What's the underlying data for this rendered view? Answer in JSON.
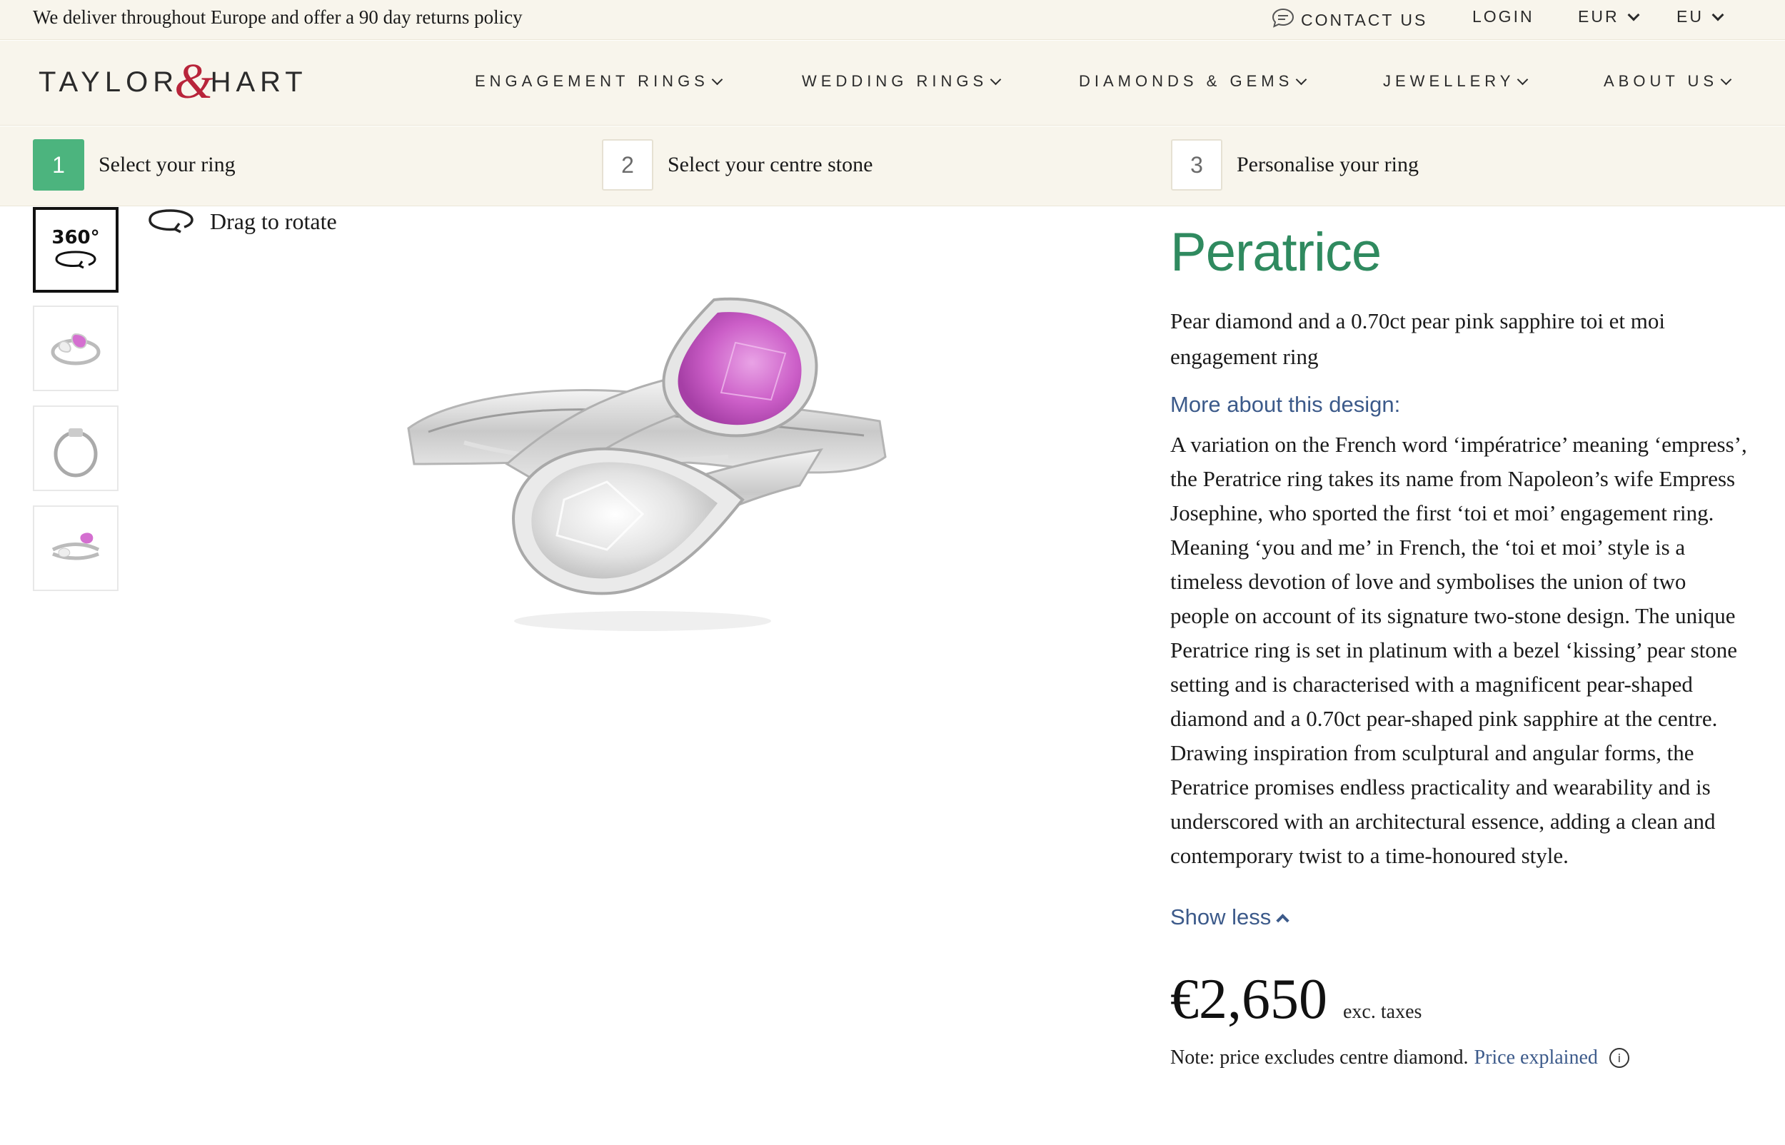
{
  "topbar": {
    "promo": "We deliver throughout Europe and offer a 90 day returns policy",
    "contact": "CONTACT US",
    "login": "LOGIN",
    "currency": "EUR",
    "region": "EU"
  },
  "logo": {
    "left": "TAYLOR",
    "amp": "&",
    "right": "HART"
  },
  "nav": [
    {
      "label": "ENGAGEMENT RINGS"
    },
    {
      "label": "WEDDING RINGS"
    },
    {
      "label": "DIAMONDS & GEMS"
    },
    {
      "label": "JEWELLERY"
    },
    {
      "label": "ABOUT US"
    }
  ],
  "steps": [
    {
      "num": "1",
      "label": "Select your ring"
    },
    {
      "num": "2",
      "label": "Select your centre stone"
    },
    {
      "num": "3",
      "label": "Personalise your ring"
    }
  ],
  "viewer": {
    "badge": "360°",
    "hint": "Drag to rotate"
  },
  "product": {
    "title": "Peratrice",
    "subtitle": "Pear diamond and a 0.70ct pear pink sapphire toi et moi engagement ring",
    "more_heading": "More about this design:",
    "description": "A variation on the French word ‘impératrice’ meaning ‘empress’, the Peratrice ring takes its name from Napoleon’s wife Empress Josephine, who sported the first ‘toi et moi’ engagement ring. Meaning ‘you and me’ in French, the ‘toi et moi’ style is a timeless devotion of love and symbolises the union of two people on account of its signature two-stone design. The unique Peratrice ring is set in platinum with a bezel ‘kissing’ pear stone setting and is characterised with a magnificent pear-shaped diamond and a 0.70ct pear-shaped pink sapphire at the centre. Drawing inspiration from sculptural and angular forms, the Peratrice promises endless practicality and wearability and is underscored with an architectural essence, adding a clean and contemporary twist to a time-honoured style.",
    "show_less": "Show less",
    "price": "€2,650",
    "tax_note": "exc. taxes",
    "note": "Note: price excludes centre diamond.",
    "price_link": "Price explained"
  },
  "colors": {
    "brand_green": "#2f8a5f",
    "step_active": "#4cb47e",
    "link_blue": "#3c5a8a",
    "logo_red": "#b8243a",
    "cream": "#f8f5ec"
  }
}
